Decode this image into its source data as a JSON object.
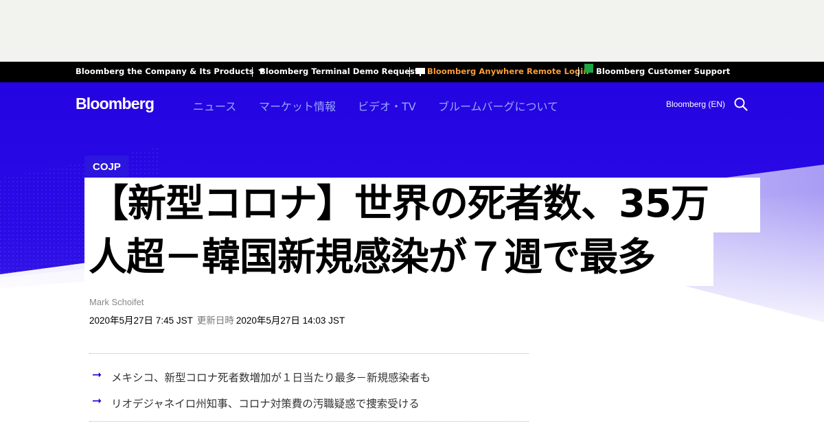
{
  "utility_bar": {
    "company_label": "Bloomberg the Company & Its Products",
    "terminal_demo_label": "Bloomberg Terminal Demo Request",
    "anywhere_label": "Bloomberg Anywhere Remote Login",
    "support_label": "Bloomberg Customer Support"
  },
  "header": {
    "logo": "Bloomberg",
    "nav": [
      "ニュース",
      "マーケット情報",
      "ビデオ・TV",
      "ブルームバーグについて"
    ],
    "edition": "Bloomberg (EN)"
  },
  "article": {
    "category": "COJP",
    "headline_line1": "【新型コロナ】世界の死者数、35万",
    "headline_line2": "人超－韓国新規感染が７週で最多",
    "author": "Mark Schoifet",
    "published": "2020年5月27日 7:45 JST",
    "updated_label": "更新日時",
    "updated": "2020年5月27日 14:03 JST"
  },
  "related": [
    "メキシコ、新型コロナ死者数増加が１日当たり最多－新規感染者も",
    "リオデジャネイロ州知事、コロナ対策費の汚職疑惑で捜索受ける"
  ],
  "colors": {
    "hero_blue": "#2404e0",
    "accent_orange": "#fa9d3a",
    "nav_text": "#9aa6ff"
  }
}
